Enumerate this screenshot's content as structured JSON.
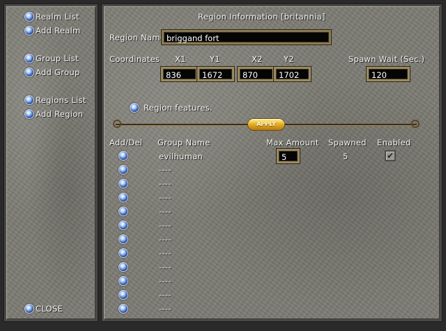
{
  "sidebar": {
    "items": [
      {
        "label": "Realm List"
      },
      {
        "label": "Add Realm"
      },
      {
        "label": "Group List"
      },
      {
        "label": "Add Group"
      },
      {
        "label": "Regions List"
      },
      {
        "label": "Add Region"
      }
    ],
    "close_label": "CLOSE"
  },
  "region": {
    "title": "Region Information [britannia]",
    "name_label": "Region Name",
    "name_value": "briggand fort",
    "coords_label": "Coordinates",
    "x1_label": "X1",
    "y1_label": "Y1",
    "x2_label": "X2",
    "y2_label": "Y2",
    "x1": "836",
    "y1": "1672",
    "x2": "870",
    "y2": "1702",
    "spawn_wait_label": "Spawn Wait (Sec.)",
    "spawn_wait": "120",
    "features_label": "Region features.",
    "apply_label": "APPLY"
  },
  "groups": {
    "headers": {
      "add_del": "Add/Del",
      "group_name": "Group Name",
      "max_amount": "Max Amount",
      "spawned": "Spawned",
      "enabled": "Enabled"
    },
    "first_row": {
      "name": "evilhuman",
      "max_amount": "5",
      "spawned": "5",
      "enabled": true,
      "check_glyph": "✔"
    },
    "empty_label": "----"
  }
}
